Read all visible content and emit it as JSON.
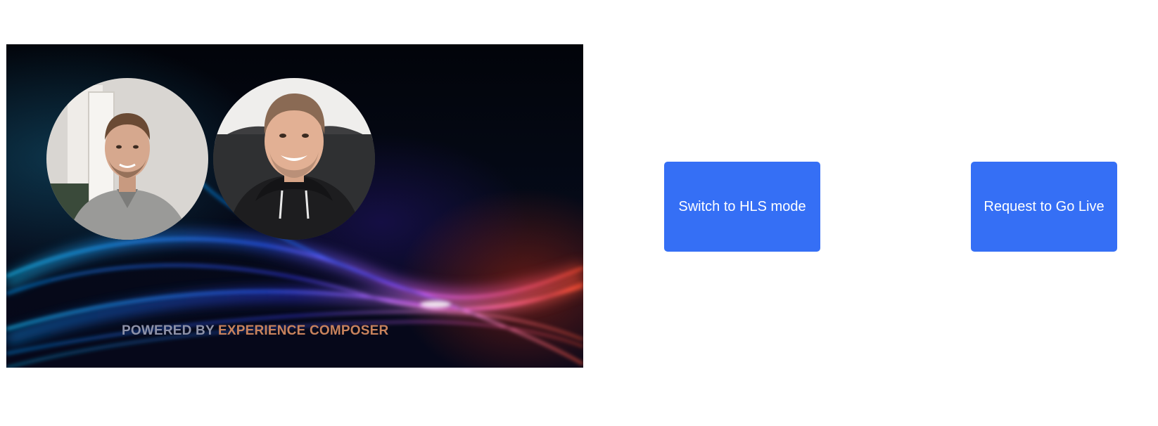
{
  "stage": {
    "watermark_prefix": "POWERED BY",
    "watermark_brand": "EXPERIENCE COMPOSER",
    "participants": [
      {
        "avatar": "participant-video-1"
      },
      {
        "avatar": "participant-video-2"
      }
    ]
  },
  "actions": {
    "switch_hls_label": "Switch to HLS mode",
    "go_live_label": "Request to Go Live"
  },
  "colors": {
    "button": "#356ff5",
    "button_text": "#ffffff",
    "watermark_prefix": "#8e92a8",
    "watermark_brand": "#c8825c"
  }
}
